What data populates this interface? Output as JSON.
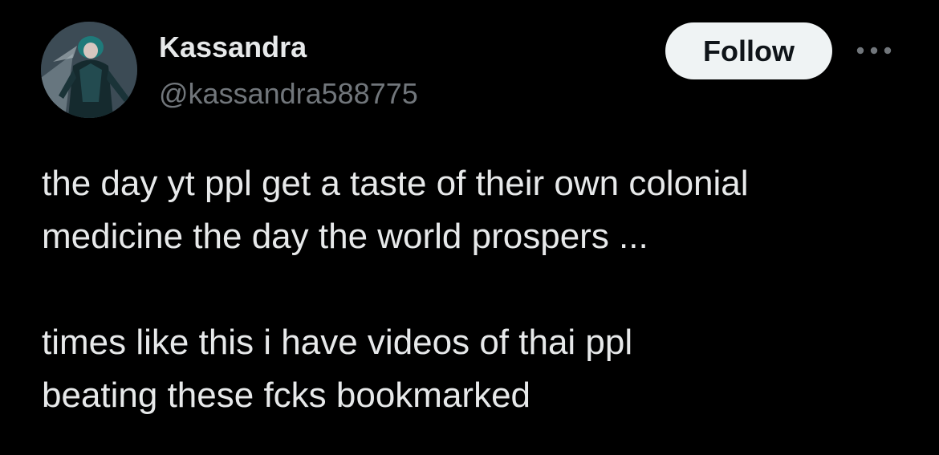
{
  "author": {
    "display_name": "Kassandra",
    "handle": "@kassandra588775",
    "avatar_icon": "profile-avatar"
  },
  "actions": {
    "follow_label": "Follow",
    "more_icon": "more-horizontal-icon"
  },
  "tweet": {
    "paragraphs": [
      "the day yt ppl get a taste of their own colonial\nmedicine the day the world prospers ...",
      "times like this i have videos of thai ppl\nbeating these fcks bookmarked"
    ]
  },
  "colors": {
    "background": "#000000",
    "text_primary": "#e7e9ea",
    "text_secondary": "#71767b",
    "follow_button_bg": "#eff3f4",
    "follow_button_text": "#0f1419"
  }
}
